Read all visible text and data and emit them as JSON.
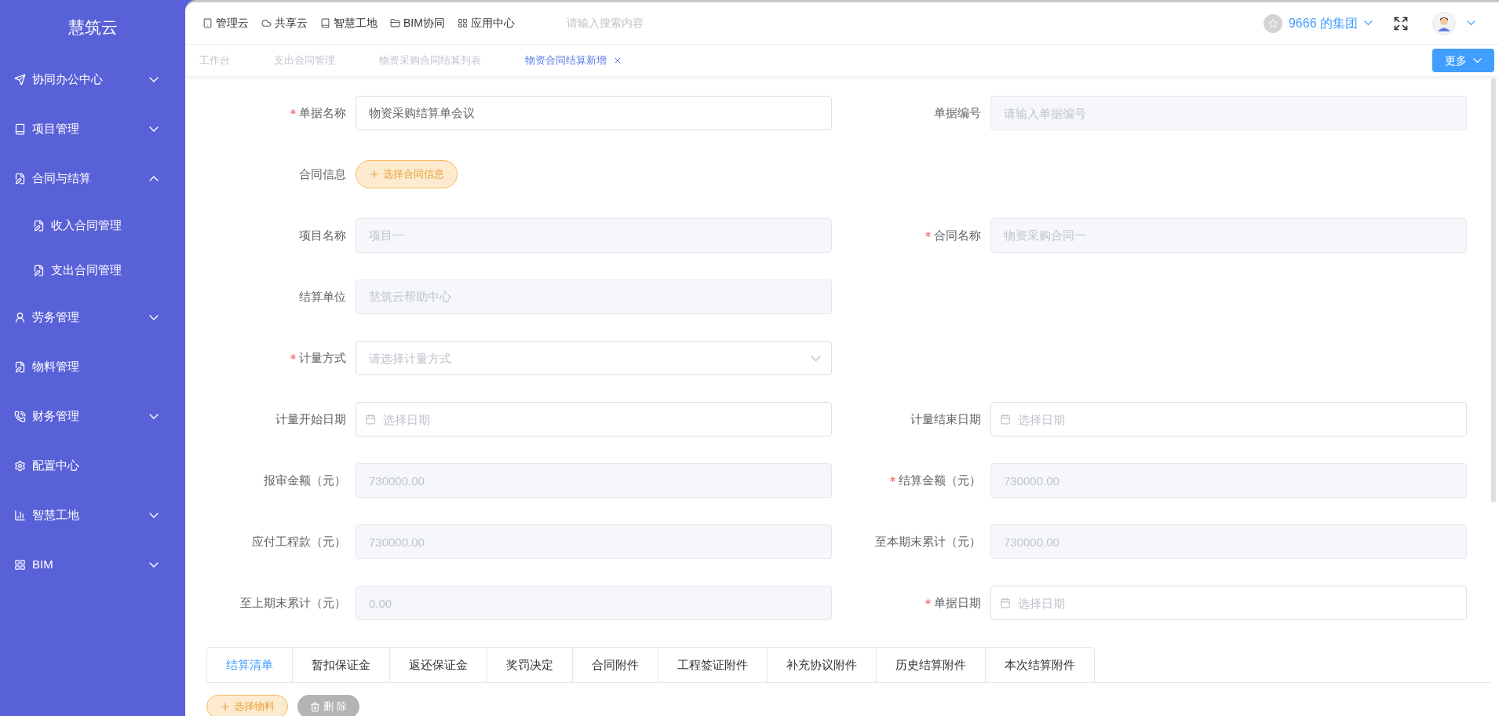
{
  "sidebar": {
    "title": "慧筑云",
    "items": [
      {
        "label": "协同办公中心",
        "expanded": false
      },
      {
        "label": "项目管理",
        "expanded": false
      },
      {
        "label": "合同与结算",
        "expanded": true,
        "children": [
          {
            "label": "收入合同管理"
          },
          {
            "label": "支出合同管理"
          }
        ]
      },
      {
        "label": "劳务管理",
        "expanded": false
      },
      {
        "label": "物料管理"
      },
      {
        "label": "财务管理",
        "expanded": false
      },
      {
        "label": "配置中心"
      },
      {
        "label": "智慧工地",
        "expanded": false
      },
      {
        "label": "BIM",
        "expanded": false
      }
    ]
  },
  "top_nav": {
    "items": [
      {
        "label": "管理云"
      },
      {
        "label": "共享云"
      },
      {
        "label": "智慧工地"
      },
      {
        "label": "BIM协同"
      },
      {
        "label": "应用中心"
      }
    ],
    "search": {
      "placeholder": "请输入搜索内容"
    },
    "organization": "9666 的集团"
  },
  "page_tabs": {
    "tabs": [
      {
        "label": "工作台",
        "selected": false,
        "closable": false
      },
      {
        "label": "支出合同管理",
        "selected": false,
        "closable": false
      },
      {
        "label": "物资采购合同结算列表",
        "selected": false,
        "closable": false
      },
      {
        "label": "物资合同结算新增",
        "selected": true,
        "closable": true
      }
    ],
    "more_button": "更多"
  },
  "form": {
    "rows": [
      {
        "left": {
          "label": "单据名称",
          "required": true,
          "kind": "text",
          "value": "物资采购结算单会议",
          "disabled": false
        },
        "right": {
          "label": "单据编号",
          "required": false,
          "kind": "text",
          "placeholder": "请输入单据编号",
          "disabled": true
        }
      },
      {
        "left": {
          "label": "合同信息",
          "required": false,
          "kind": "button",
          "button_label": "选择合同信息"
        }
      },
      {
        "left": {
          "label": "项目名称",
          "required": false,
          "kind": "text",
          "value": "项目一",
          "disabled": true
        },
        "right": {
          "label": "合同名称",
          "required": true,
          "kind": "text",
          "value": "物资采购合同一",
          "disabled": true
        }
      },
      {
        "left": {
          "label": "结算单位",
          "required": false,
          "kind": "text",
          "value": "慧筑云帮助中心",
          "disabled": true
        }
      },
      {
        "left": {
          "label": "计量方式",
          "required": true,
          "kind": "select",
          "placeholder": "请选择计量方式"
        }
      },
      {
        "left": {
          "label": "计量开始日期",
          "required": false,
          "kind": "date",
          "placeholder": "选择日期"
        },
        "right": {
          "label": "计量结束日期",
          "required": false,
          "kind": "date",
          "placeholder": "选择日期"
        }
      },
      {
        "left": {
          "label": "报审金额（元）",
          "required": false,
          "kind": "text",
          "value": "730000.00",
          "disabled": true
        },
        "right": {
          "label": "结算金额（元）",
          "required": true,
          "kind": "text",
          "value": "730000.00",
          "disabled": true
        }
      },
      {
        "left": {
          "label": "应付工程款（元）",
          "required": false,
          "kind": "text",
          "value": "730000.00",
          "disabled": true
        },
        "right": {
          "label": "至本期末累计（元）",
          "required": false,
          "kind": "text",
          "value": "730000.00",
          "disabled": true
        }
      },
      {
        "left": {
          "label": "至上期末累计（元）",
          "required": false,
          "kind": "text",
          "value": "0.00",
          "disabled": true
        },
        "right": {
          "label": "单据日期",
          "required": true,
          "kind": "date",
          "placeholder": "选择日期"
        }
      }
    ]
  },
  "detail_tabs": [
    {
      "label": "结算清单",
      "selected": true
    },
    {
      "label": "暂扣保证金",
      "selected": false
    },
    {
      "label": "返还保证金",
      "selected": false
    },
    {
      "label": "奖罚决定",
      "selected": false
    },
    {
      "label": "合同附件",
      "selected": false
    },
    {
      "label": "工程签证附件",
      "selected": false
    },
    {
      "label": "补充协议附件",
      "selected": false
    },
    {
      "label": "历史结算附件",
      "selected": false
    },
    {
      "label": "本次结算附件",
      "selected": false
    }
  ],
  "actions": [
    {
      "kind": "add",
      "label": "选择物料"
    },
    {
      "kind": "delete",
      "label": "删 除"
    }
  ]
}
